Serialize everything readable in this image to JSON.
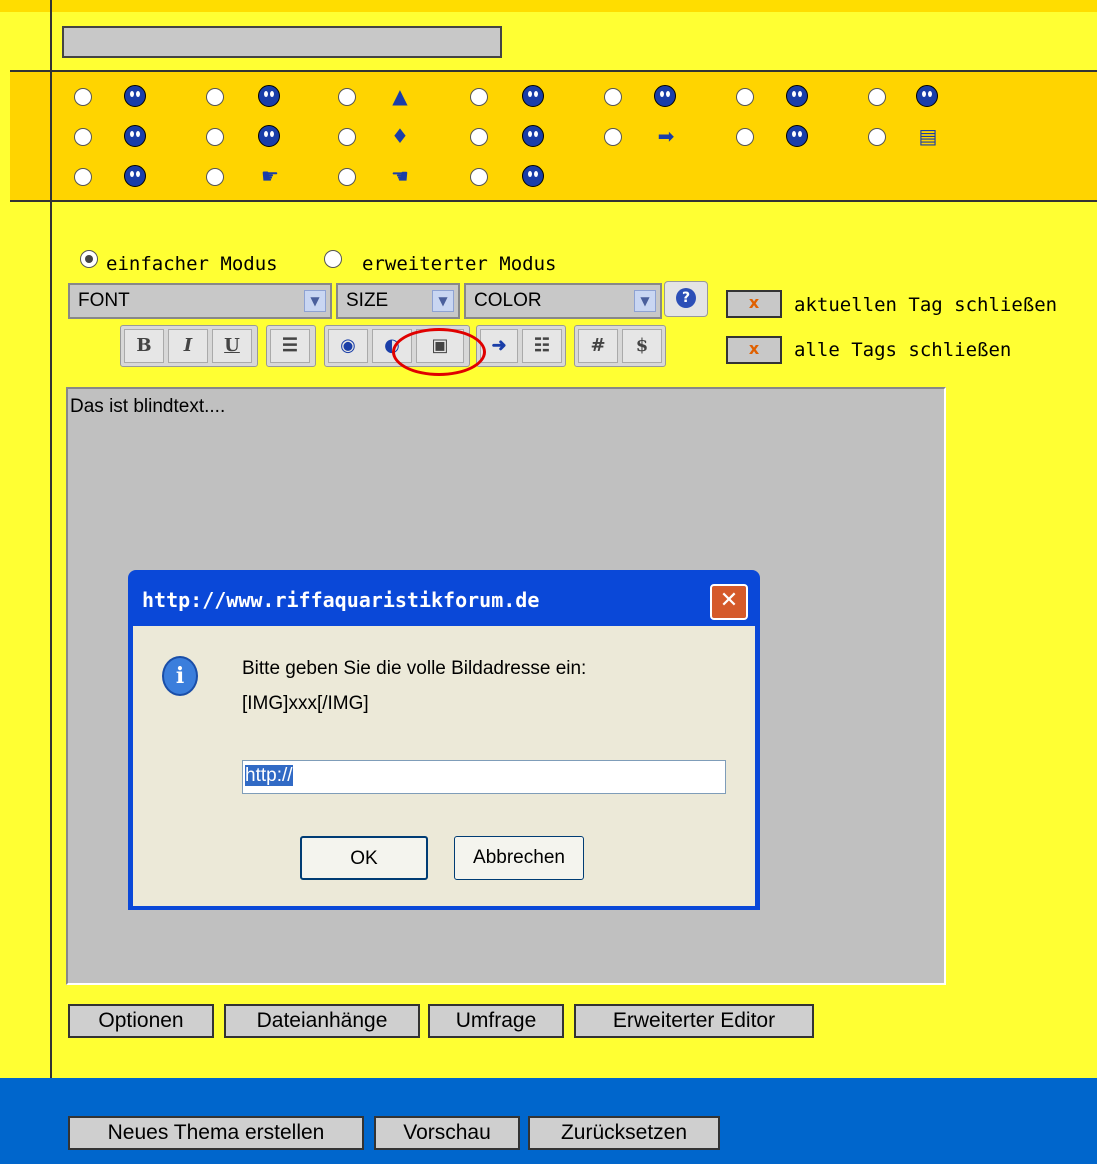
{
  "editor": {
    "mode_simple": "einfacher Modus",
    "mode_advanced": "erweiterter Modus",
    "font_select": "FONT",
    "size_select": "SIZE",
    "color_select": "COLOR",
    "close_current_tag": "aktuellen Tag schließen",
    "close_all_tags": "alle Tags schließen",
    "close_btn_x": "x",
    "toolbar": {
      "bold": "B",
      "italic": "I",
      "underline": "U",
      "hash": "#",
      "dollar": "$"
    },
    "text": "Das ist blindtext...."
  },
  "buttons": {
    "options": "Optionen",
    "attachments": "Dateianhänge",
    "poll": "Umfrage",
    "advanced_editor": "Erweiterter Editor",
    "new_topic": "Neues Thema erstellen",
    "preview": "Vorschau",
    "reset": "Zurücksetzen"
  },
  "dialog": {
    "title": "http://www.riffaquaristikforum.de",
    "message": "Bitte geben Sie die volle Bildadresse ein:",
    "message2": "[IMG]xxx[/IMG]",
    "input_value": "http://",
    "ok": "OK",
    "cancel": "Abbrechen"
  },
  "colors": {
    "page_bg": "#ffff33",
    "smiley_bar": "#ffd400",
    "bottom_bar": "#0066cc",
    "dialog_title": "#0a48d8",
    "highlight": "#e00000"
  }
}
